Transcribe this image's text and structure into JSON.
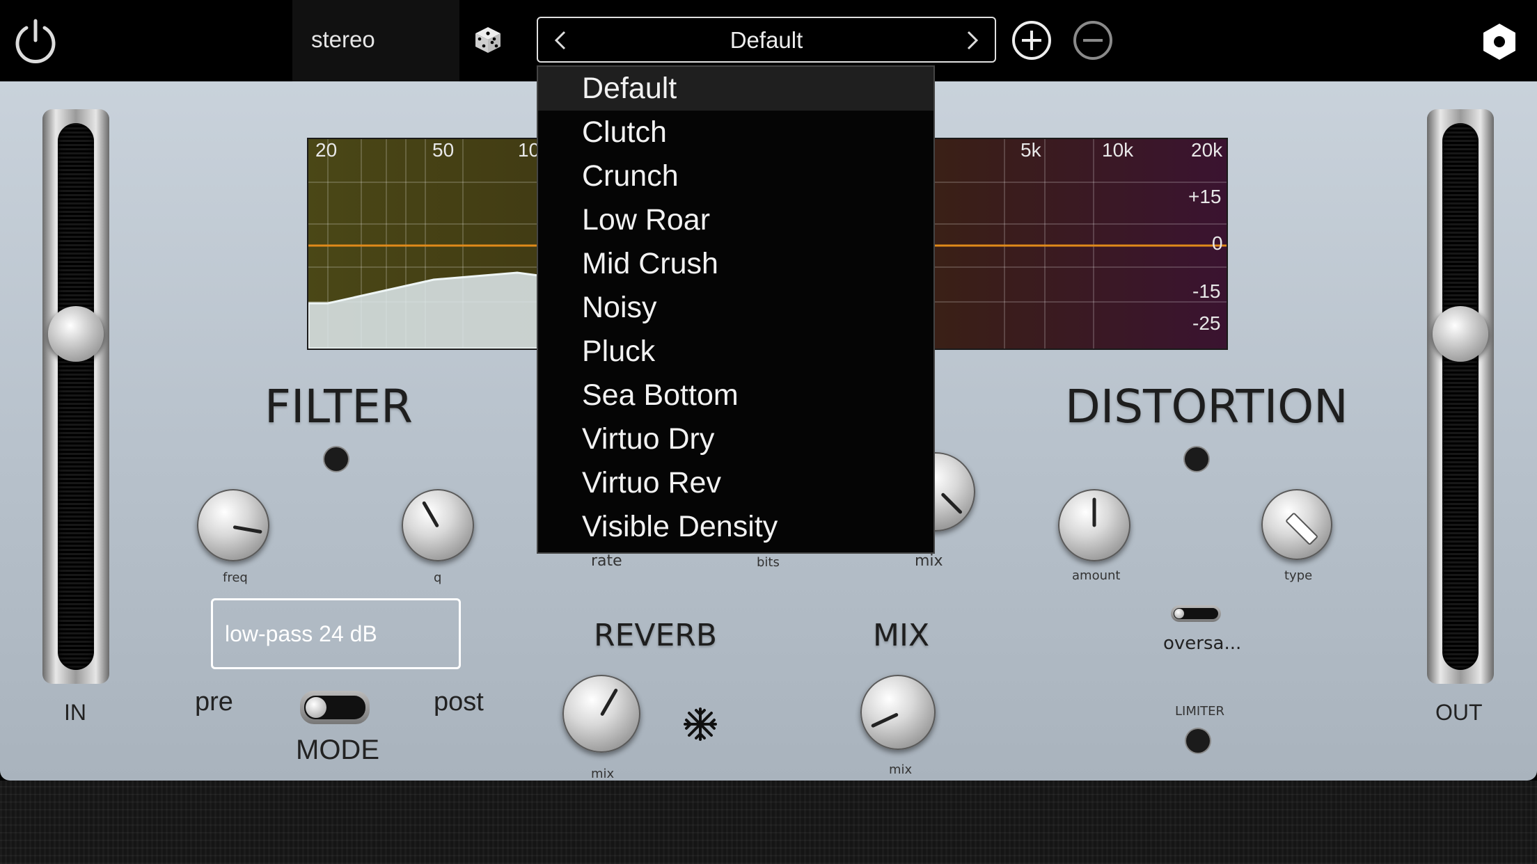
{
  "topbar": {
    "channel_mode": "stereo",
    "preset_name": "Default"
  },
  "meters": {
    "in_label": "IN",
    "out_label": "OUT"
  },
  "eq": {
    "freq_labels": [
      "20",
      "50",
      "10",
      "5k",
      "10k",
      "20k"
    ],
    "gain_labels": [
      "+15",
      "0",
      "-15",
      "-25"
    ]
  },
  "filter": {
    "title": "FILTER",
    "knob_freq_label": "freq",
    "knob_q_label": "q",
    "type_value": "low-pass  24 dB",
    "pre_label": "pre",
    "post_label": "post",
    "mode_label": "MODE"
  },
  "crusher": {
    "rate_label": "rate",
    "bits_label": "bits",
    "mix_label": "mix"
  },
  "reverb": {
    "title": "REVERB",
    "mix_label": "mix"
  },
  "mix": {
    "title": "MIX",
    "mix_label": "mix"
  },
  "distortion": {
    "title": "DISTORTION",
    "amount_label": "amount",
    "type_label": "type",
    "oversample_label": "oversa...",
    "limiter_label": "LIMITER"
  },
  "presets_menu": {
    "items": [
      "Default",
      "Clutch",
      "Crunch",
      "Low Roar",
      "Mid Crush",
      "Noisy",
      "Pluck",
      "Sea Bottom",
      "Virtuo Dry",
      "Virtuo Rev",
      "Visible Density"
    ],
    "selected_index": 0
  },
  "controls": {
    "in_level": 0.62,
    "out_level": 0.62
  }
}
